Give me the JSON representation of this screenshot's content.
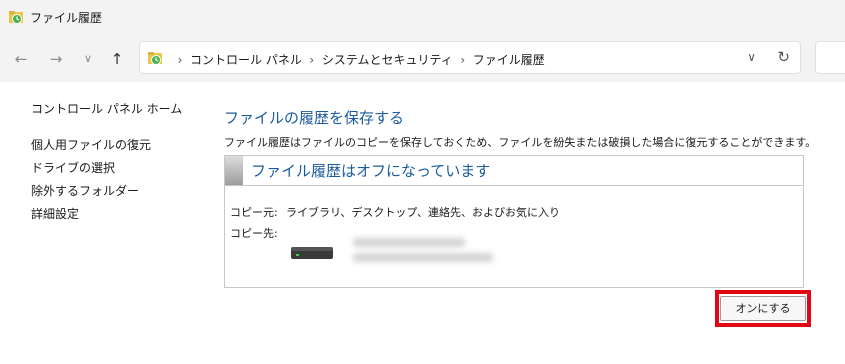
{
  "window": {
    "title": "ファイル履歴"
  },
  "navigation": {
    "back_icon": "arrow-left-icon",
    "forward_icon": "arrow-right-icon",
    "recent_icon": "chevron-down-icon",
    "up_icon": "arrow-up-icon"
  },
  "address_bar": {
    "breadcrumbs": [
      "コントロール パネル",
      "システムとセキュリティ",
      "ファイル履歴"
    ],
    "dropdown_icon": "chevron-down-icon",
    "refresh_icon": "refresh-icon"
  },
  "sidebar": {
    "home_link": "コントロール パネル ホーム",
    "links": [
      "個人用ファイルの復元",
      "ドライブの選択",
      "除外するフォルダー",
      "詳細設定"
    ]
  },
  "main": {
    "title": "ファイルの履歴を保存する",
    "description": "ファイル履歴はファイルのコピーを保存しておくため、ファイルを紛失または破損した場合に復元することができます。",
    "status": {
      "heading": "ファイル履歴はオフになっています",
      "copy_from_label": "コピー元:",
      "copy_from_value": "ライブラリ、デスクトップ、連絡先、およびお気に入り",
      "copy_to_label": "コピー先:",
      "drive_icon": "drive-icon"
    },
    "turn_on_button": "オンにする"
  },
  "colors": {
    "accent": "#1c5b9e",
    "highlight": "#e30613"
  }
}
